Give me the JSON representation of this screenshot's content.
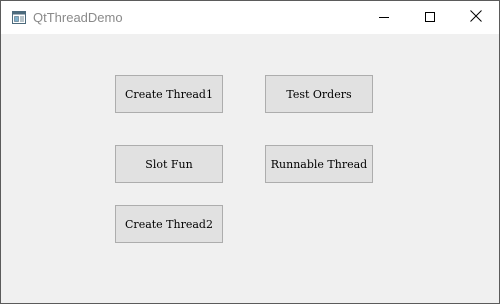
{
  "window": {
    "title": "QtThreadDemo",
    "icon": "qt-window-app-icon",
    "caption_buttons": [
      "minimize-icon",
      "maximize-icon",
      "close-icon"
    ]
  },
  "buttons": {
    "create_thread1": "Create Thread1",
    "test_orders": "Test Orders",
    "slot_fun": "Slot Fun",
    "runnable_thread": "Runnable Thread",
    "create_thread2": "Create Thread2"
  },
  "colors": {
    "background": "#f0f0f0",
    "button_face": "#e1e1e1",
    "button_border": "#adadad",
    "titlebar": "#ffffff",
    "title_text": "#8a8a8a"
  }
}
